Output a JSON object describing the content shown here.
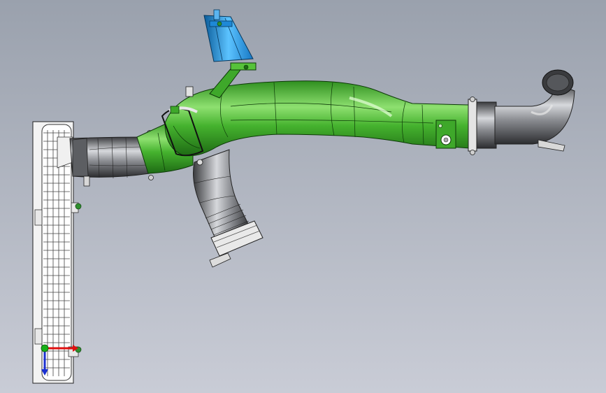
{
  "viewport": {
    "background_top": "#9aa1ad",
    "background_bottom": "#c9ccd6"
  },
  "colors": {
    "pipe_green": "#3ea82a",
    "pipe_green_light": "#8ee070",
    "pipe_green_dark": "#1e6a14",
    "pipe_gray": "#7d7f84",
    "pipe_gray_dark": "#2c2d30",
    "pipe_gray_light": "#d6d8dc",
    "bracket_blue": "#2fa4e8",
    "bracket_blue_dark": "#0b5c9a",
    "radiator_white": "#f3f3f3",
    "triad_x": "#e01010",
    "triad_y": "#18b018",
    "triad_z": "#1a2fd0"
  },
  "triad": {
    "x_axis": "X",
    "y_axis": "Y",
    "z_axis": "Z"
  }
}
